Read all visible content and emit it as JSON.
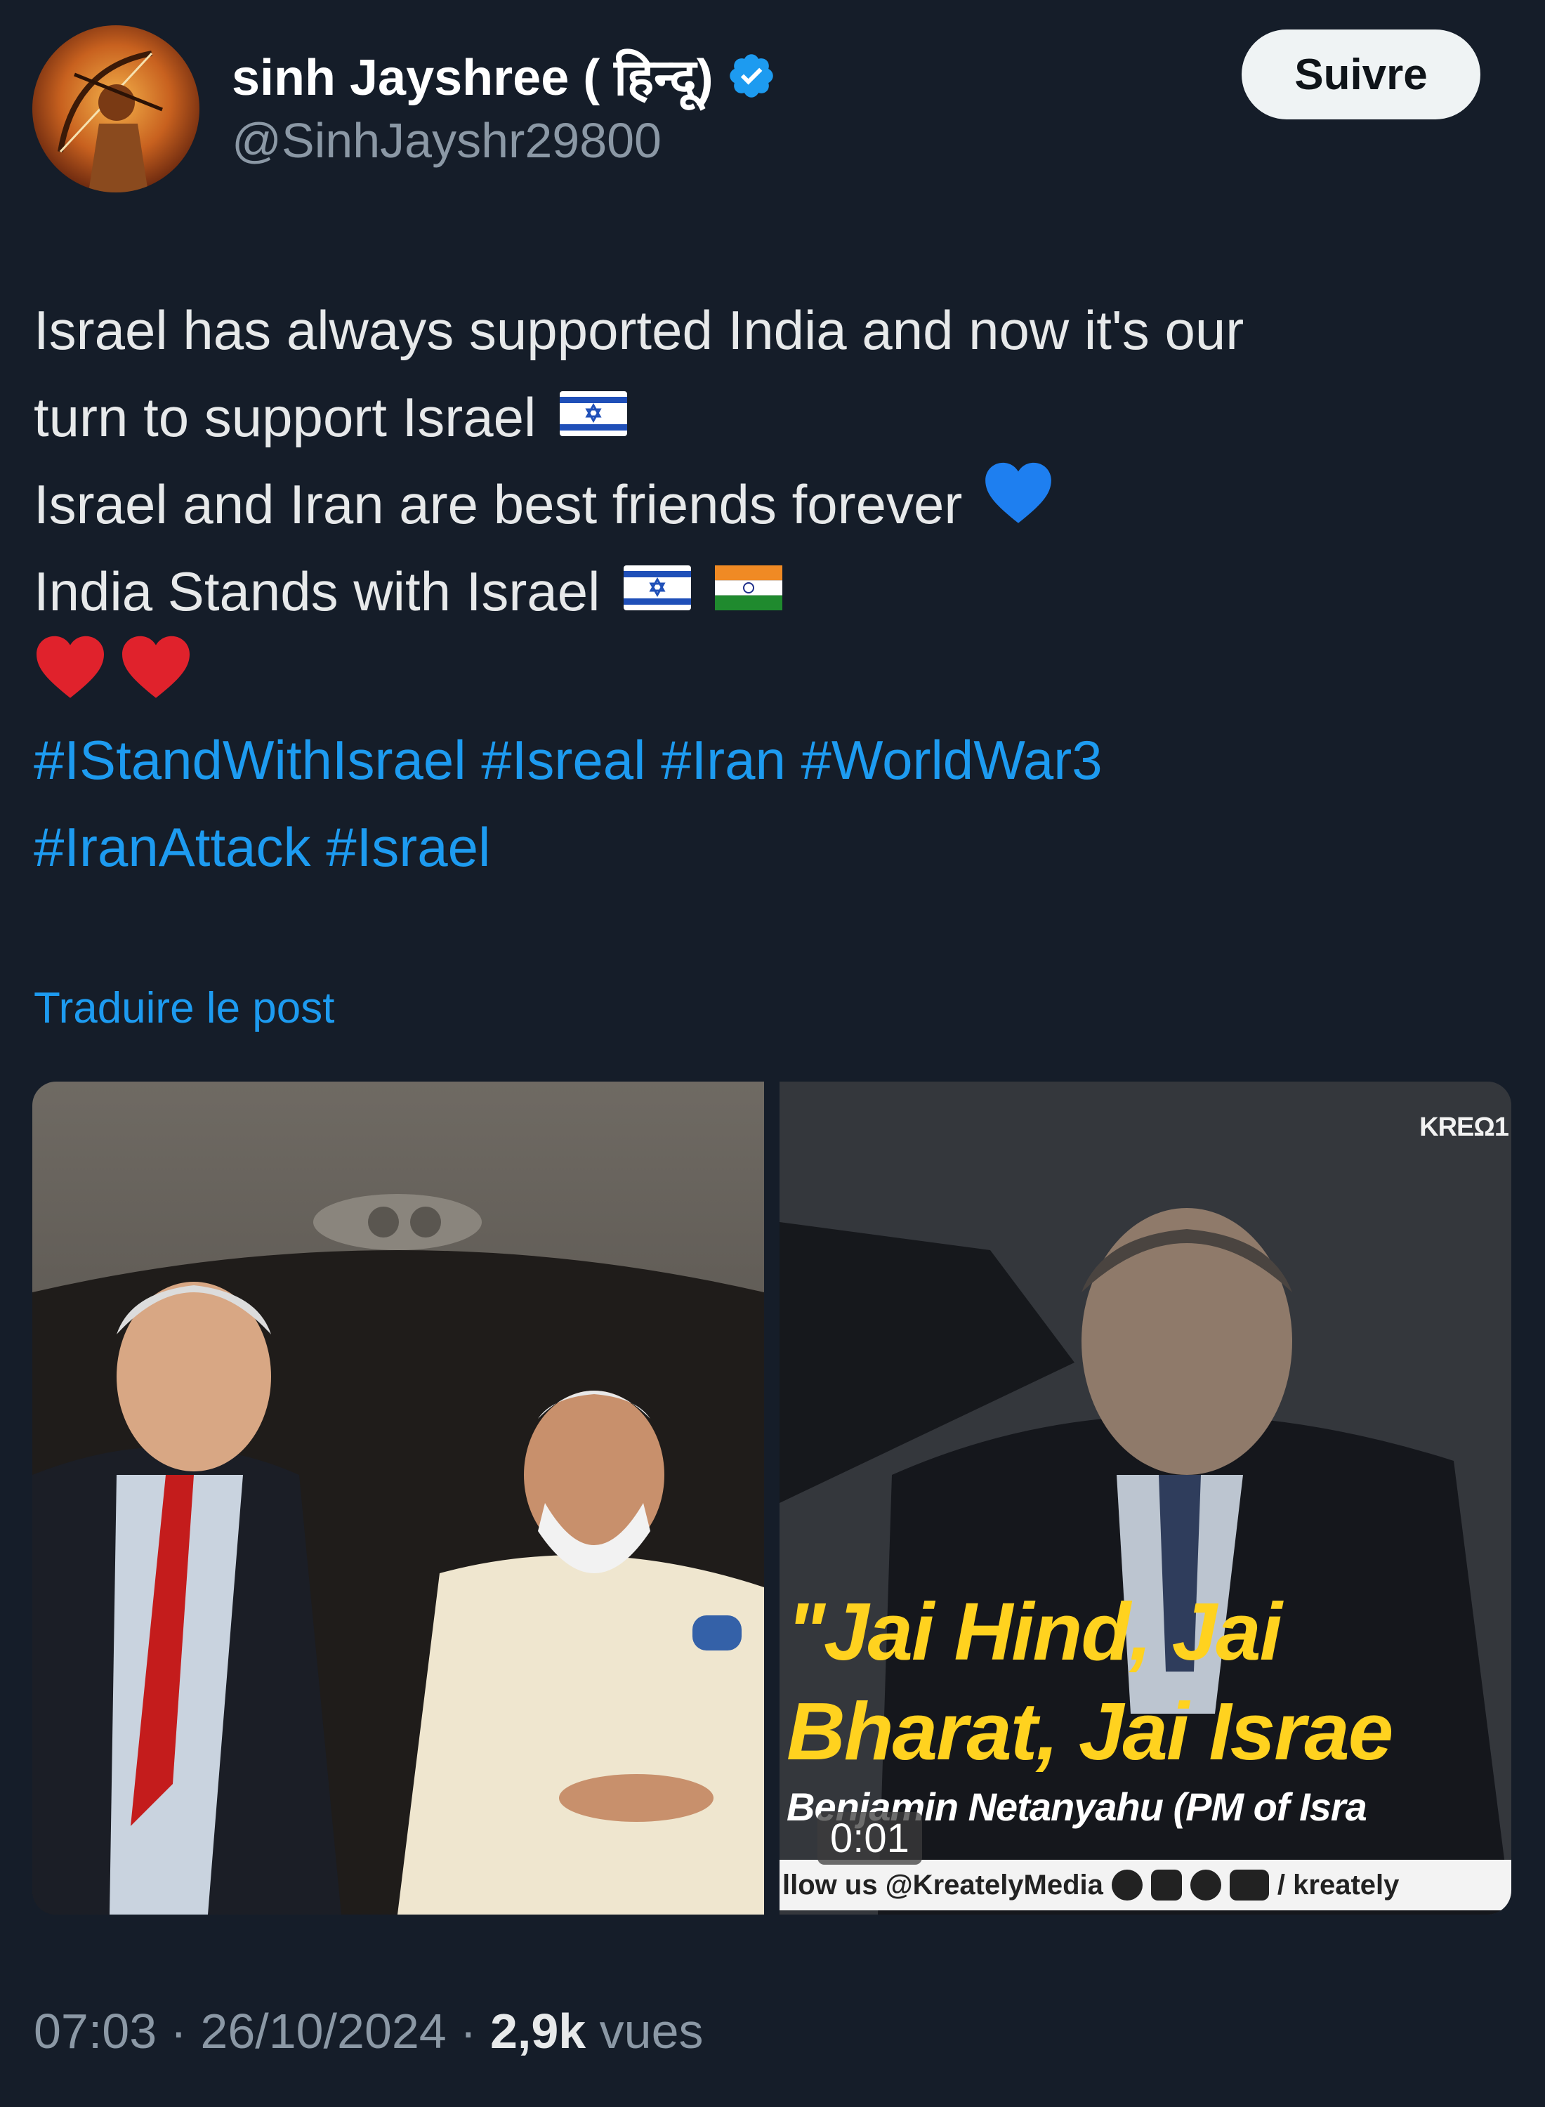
{
  "author": {
    "display_name": "sinh Jayshree ( हिन्दू)",
    "handle": "@SinhJayshr29800",
    "verified": true,
    "avatar_icon": "archer-avatar-icon"
  },
  "follow_button": {
    "label": "Suivre"
  },
  "post": {
    "lines": [
      "Israel has always supported India and now it's our",
      "turn to support Israel",
      "Israel and Iran are best friends forever",
      "India Stands with Israel"
    ],
    "hashtag_lines": [
      "#IStandWithIsrael #Isreal #Iran #WorldWar3",
      "#IranAttack  #Israel"
    ],
    "emojis": [
      "israel-flag-icon",
      "blue-heart-icon",
      "israel-flag-icon",
      "india-flag-icon",
      "red-heart-icon",
      "red-heart-icon"
    ]
  },
  "translate_link": {
    "label": "Traduire le post"
  },
  "media": {
    "right": {
      "watermark": "KREΩ1",
      "caption_quote": "\"Jai Hind, Jai\nBharat, Jai Israe",
      "caption_name": "Benjamin Netanyahu (PM of Isra",
      "video_time": "0:01",
      "social_text": "llow us @KreatelyMedia",
      "social_handle": "/ kreately"
    }
  },
  "footer": {
    "time": "07:03",
    "separator": " · ",
    "date": "26/10/2024",
    "views_count": "2,9k",
    "views_label": " vues"
  },
  "colors": {
    "background": "#151d29",
    "link_blue": "#1d9bf0",
    "muted_text": "#8b98a5",
    "caption_yellow": "#ffd21f"
  }
}
